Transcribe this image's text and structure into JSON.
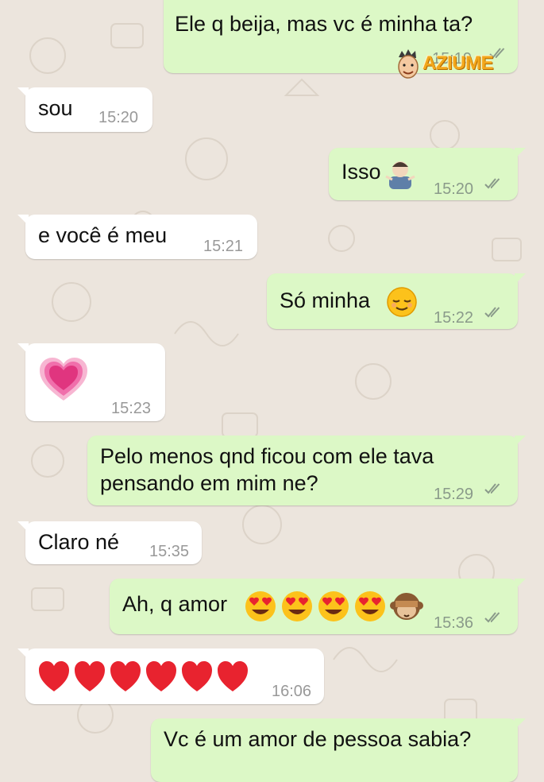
{
  "conversation": {
    "messages": [
      {
        "direction": "outgoing",
        "text": "Ele q beija, mas vc é minha ta?",
        "time": "15:19",
        "status": "read"
      },
      {
        "direction": "incoming",
        "text": "sou",
        "time": "15:20"
      },
      {
        "direction": "outgoing",
        "text": "Isso",
        "emojis": [
          "person-shrugging"
        ],
        "time": "15:20",
        "status": "read"
      },
      {
        "direction": "incoming",
        "text": "e você é meu",
        "time": "15:21"
      },
      {
        "direction": "outgoing",
        "text": "Só minha",
        "emojis": [
          "relieved-face"
        ],
        "time": "15:22",
        "status": "read"
      },
      {
        "direction": "incoming",
        "text": "",
        "emojis": [
          "growing-heart"
        ],
        "time": "15:23"
      },
      {
        "direction": "outgoing",
        "text_line1": "Pelo menos qnd ficou com ele tava",
        "text_line2": "pensando em mim ne?",
        "time": "15:29",
        "status": "read"
      },
      {
        "direction": "incoming",
        "text": "Claro né",
        "time": "15:35"
      },
      {
        "direction": "outgoing",
        "text": "Ah, q amor",
        "emojis": [
          "heart-eyes",
          "heart-eyes",
          "heart-eyes",
          "heart-eyes",
          "see-no-evil-monkey"
        ],
        "time": "15:36",
        "status": "read"
      },
      {
        "direction": "incoming",
        "text": "",
        "emojis": [
          "red-heart",
          "red-heart",
          "red-heart",
          "red-heart",
          "red-heart",
          "red-heart"
        ],
        "time": "16:06"
      },
      {
        "direction": "outgoing",
        "text": "Vc é um amor de pessoa sabia?"
      }
    ]
  },
  "watermark": {
    "text": "AZIUME",
    "icon": "cartoon-face-icon"
  },
  "colors": {
    "outgoing_bubble": "#dcf8c6",
    "incoming_bubble": "#ffffff",
    "wallpaper": "#ece5dd",
    "read_tick": "#8a9a8a",
    "watermark": "#f2a71b"
  }
}
